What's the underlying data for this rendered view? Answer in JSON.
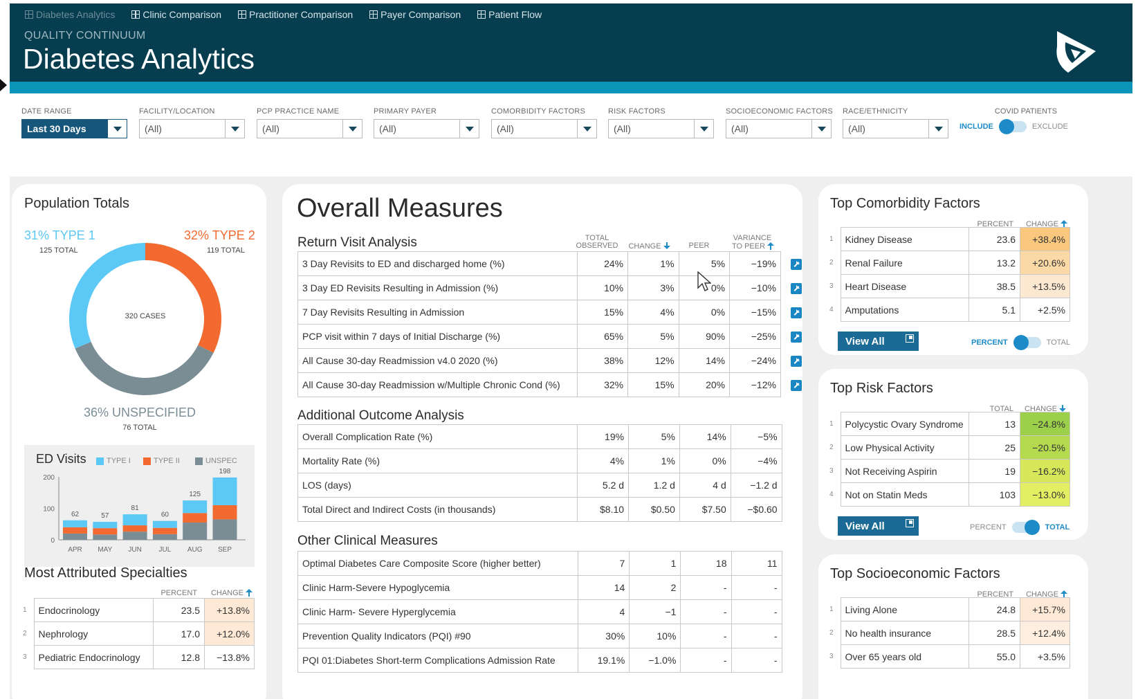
{
  "nav": {
    "tabs": [
      {
        "label": "Diabetes Analytics",
        "active": true
      },
      {
        "label": "Clinic Comparison"
      },
      {
        "label": "Practitioner Comparison"
      },
      {
        "label": "Payer Comparison"
      },
      {
        "label": "Patient Flow"
      }
    ]
  },
  "header": {
    "subtitle": "QUALITY CONTINUUM",
    "title": "Diabetes Analytics"
  },
  "filters": [
    {
      "label": "DATE RANGE",
      "value": "Last 30 Days"
    },
    {
      "label": "FACILITY/LOCATION",
      "value": "(All)"
    },
    {
      "label": "PCP PRACTICE NAME",
      "value": "(All)"
    },
    {
      "label": "PRIMARY PAYER",
      "value": "(All)"
    },
    {
      "label": "COMORBIDITY FACTORS",
      "value": "(All)"
    },
    {
      "label": "RISK FACTORS",
      "value": "(All)"
    },
    {
      "label": "SOCIOECONOMIC FACTORS",
      "value": "(All)"
    },
    {
      "label": "RACE/ETHNICITY",
      "value": "(All)"
    }
  ],
  "covid": {
    "label": "COVID PATIENTS",
    "on": "INCLUDE",
    "off": "EXCLUDE"
  },
  "colors": {
    "type1": "#5bc8f5",
    "type2": "#f26a30",
    "unspec": "#7a8d95",
    "accent": "#1d8bc7"
  },
  "population": {
    "title": "Population Totals",
    "type1_pct": "31%  TYPE 1",
    "type1_total": "125 TOTAL",
    "type2_pct": "32%  TYPE 2",
    "type2_total": "119 TOTAL",
    "unspec_pct": "36%  UNSPECIFIED",
    "unspec_total": "76 TOTAL",
    "center": "320 CASES"
  },
  "chart_data": [
    {
      "type": "pie",
      "title": "Population Totals",
      "categories": [
        "TYPE 1",
        "TYPE 2",
        "UNSPECIFIED"
      ],
      "values": [
        31,
        32,
        36
      ],
      "totals": [
        125,
        119,
        76
      ],
      "center_label": "320 CASES"
    },
    {
      "type": "bar",
      "stacked": true,
      "title": "ED Visits",
      "categories": [
        "APR",
        "MAY",
        "JUN",
        "JUL",
        "AUG",
        "SEP"
      ],
      "series": [
        {
          "name": "UNSPEC",
          "values": [
            20,
            17,
            26,
            18,
            55,
            65
          ]
        },
        {
          "name": "TYPE II",
          "values": [
            20,
            20,
            20,
            20,
            30,
            45
          ]
        },
        {
          "name": "TYPE I",
          "values": [
            22,
            20,
            35,
            22,
            40,
            88
          ]
        }
      ],
      "totals": [
        62,
        57,
        81,
        60,
        125,
        198
      ],
      "yticks": [
        0,
        100,
        200
      ],
      "ylim": [
        0,
        200
      ]
    }
  ],
  "ed": {
    "title": "ED Visits",
    "legend": [
      "TYPE I",
      "TYPE II",
      "UNSPEC"
    ]
  },
  "specialties": {
    "title": "Most Attributed Specialties",
    "col_percent": "PERCENT",
    "col_change": "CHANGE",
    "rows": [
      {
        "idx": "1",
        "name": "Endocrinology",
        "value": "23.5",
        "change": "+13.8%",
        "bg": "#fde9d6"
      },
      {
        "idx": "2",
        "name": "Nephrology",
        "value": "17.0",
        "change": "+12.0%",
        "bg": "#fde9d6"
      },
      {
        "idx": "3",
        "name": "Pediatric Endocrinology",
        "value": "12.8",
        "change": "−13.8%",
        "bg": "#ffffff"
      }
    ]
  },
  "overall": {
    "title": "Overall Measures",
    "col_total": [
      "TOTAL",
      "OBSERVED"
    ],
    "col_change": "CHANGE",
    "col_peer": "PEER",
    "col_variance": [
      "VARIANCE",
      "TO PEER"
    ],
    "return_visit": {
      "title": "Return Visit Analysis",
      "rows": [
        [
          "3 Day Revisits to ED and discharged home (%)",
          "24%",
          "1%",
          "5%",
          "−19%"
        ],
        [
          "3 Day  ED Revisits Resulting in Admission (%)",
          "10%",
          "3%",
          "0%",
          "−10%"
        ],
        [
          "7 Day Revisits Resulting in Admission",
          "15%",
          "4%",
          "0%",
          "−15%"
        ],
        [
          "PCP visit within 7 days of  Initial Discharge (%)",
          "65%",
          "5%",
          "90%",
          "−25%"
        ],
        [
          "All Cause 30-day Readmission v4.0 2020 (%)",
          "38%",
          "12%",
          "14%",
          "−24%"
        ],
        [
          "All Cause 30-day Readmission w/Multiple Chronic Cond (%)",
          "32%",
          "15%",
          "20%",
          "−12%"
        ]
      ]
    },
    "additional": {
      "title": "Additional Outcome Analysis",
      "rows": [
        [
          "Overall Complication Rate (%)",
          "19%",
          "5%",
          "14%",
          "−5%"
        ],
        [
          "Mortality Rate (%)",
          "4%",
          "1%",
          "0%",
          "−4%"
        ],
        [
          "LOS (days)",
          "5.2 d",
          "1.2 d",
          "4 d",
          "−1.2 d"
        ],
        [
          "Total Direct and Indirect Costs (in thousands)",
          "$8.10",
          "$0.50",
          "$7.50",
          "−$0.60"
        ]
      ]
    },
    "other": {
      "title": "Other Clinical Measures",
      "rows": [
        [
          "Optimal Diabetes Care Composite Score (higher better)",
          "7",
          "1",
          "18",
          "11"
        ],
        [
          "Clinic Harm-Severe Hypoglycemia",
          "14",
          "2",
          "-",
          "-"
        ],
        [
          "Clinic Harm- Severe Hyperglycemia",
          "4",
          "−1",
          "-",
          "-"
        ],
        [
          "Prevention Quality Indicators (PQI) #90",
          "30%",
          "10%",
          "-",
          "-"
        ],
        [
          "PQI 01:Diabetes Short-term Complications Admission Rate",
          "19.1%",
          "−1.0%",
          "-",
          "-"
        ]
      ]
    }
  },
  "comorbidity": {
    "title": "Top Comorbidity Factors",
    "col_value": "PERCENT",
    "col_change": "CHANGE",
    "rows": [
      {
        "idx": "1",
        "name": "Kidney Disease",
        "value": "23.6",
        "change": "+38.4%",
        "bg": "#f9c77e"
      },
      {
        "idx": "2",
        "name": "Renal Failure",
        "value": "13.2",
        "change": "+20.6%",
        "bg": "#fbd9a6"
      },
      {
        "idx": "3",
        "name": "Heart Disease",
        "value": "38.5",
        "change": "+13.5%",
        "bg": "#fde9d2"
      },
      {
        "idx": "4",
        "name": "Amputations",
        "value": "5.1",
        "change": "+2.5%",
        "bg": "#ffffff"
      }
    ],
    "view_all": "View All",
    "toggle_a": "PERCENT",
    "toggle_b": "TOTAL"
  },
  "risk": {
    "title": "Top Risk Factors",
    "col_value": "TOTAL",
    "col_change": "CHANGE",
    "rows": [
      {
        "idx": "1",
        "name": "Polycystic Ovary Syndrome",
        "value": "13",
        "change": "−24.8%",
        "bg": "#9ccf4a"
      },
      {
        "idx": "2",
        "name": "Low Physical Activity",
        "value": "25",
        "change": "−20.5%",
        "bg": "#b5d94f"
      },
      {
        "idx": "3",
        "name": "Not Receiving Aspirin",
        "value": "19",
        "change": "−16.2%",
        "bg": "#d6e85a"
      },
      {
        "idx": "4",
        "name": "Not on Statin Meds",
        "value": "103",
        "change": "−13.0%",
        "bg": "#e4ee62"
      }
    ],
    "view_all": "View All",
    "toggle_a": "PERCENT",
    "toggle_b": "TOTAL"
  },
  "socio": {
    "title": "Top Socioeconomic Factors",
    "col_value": "PERCENT",
    "col_change": "CHANGE",
    "rows": [
      {
        "idx": "1",
        "name": "Living Alone",
        "value": "24.8",
        "change": "+15.7%",
        "bg": "#fde9d6"
      },
      {
        "idx": "2",
        "name": "No health insurance",
        "value": "28.5",
        "change": "+12.4%",
        "bg": "#fdeee0"
      },
      {
        "idx": "3",
        "name": "Over 65 years old",
        "value": "55.0",
        "change": "+3.5%",
        "bg": "#ffffff"
      }
    ]
  }
}
